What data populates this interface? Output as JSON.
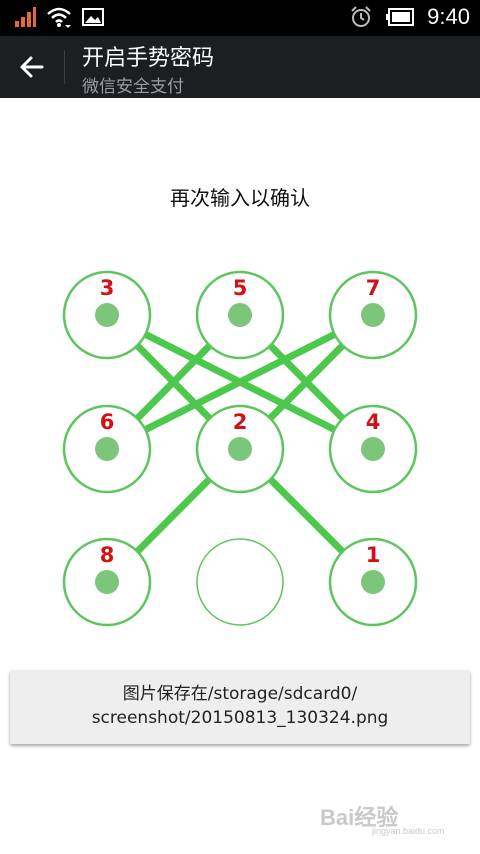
{
  "status_bar": {
    "time": "9:40",
    "icons": [
      "signal-icon",
      "wifi-icon",
      "image-notification-icon",
      "alarm-icon",
      "battery-icon"
    ]
  },
  "app_bar": {
    "back_icon": "back-arrow-icon",
    "title": "开启手势密码",
    "subtitle": "微信安全支付"
  },
  "prompt": "再次输入以确认",
  "pattern": {
    "nodes": [
      {
        "label": "3",
        "selected": true
      },
      {
        "label": "5",
        "selected": true
      },
      {
        "label": "7",
        "selected": true
      },
      {
        "label": "6",
        "selected": true
      },
      {
        "label": "2",
        "selected": true
      },
      {
        "label": "4",
        "selected": true
      },
      {
        "label": "8",
        "selected": true
      },
      {
        "label": "",
        "selected": false
      },
      {
        "label": "1",
        "selected": true
      }
    ],
    "order": [
      "1",
      "2",
      "3",
      "4",
      "5",
      "6",
      "7",
      "8"
    ],
    "line_color": "#4cc94c",
    "ring_color": "#5ec45e",
    "dot_color": "#7cc67c",
    "number_color": "#d01218"
  },
  "toast": {
    "line1": "图片保存在/storage/sdcard0/",
    "line2": "screenshot/20150813_130324.png"
  },
  "watermark": {
    "main": "Bai经验",
    "sub": "jingyan.baidu.com"
  }
}
